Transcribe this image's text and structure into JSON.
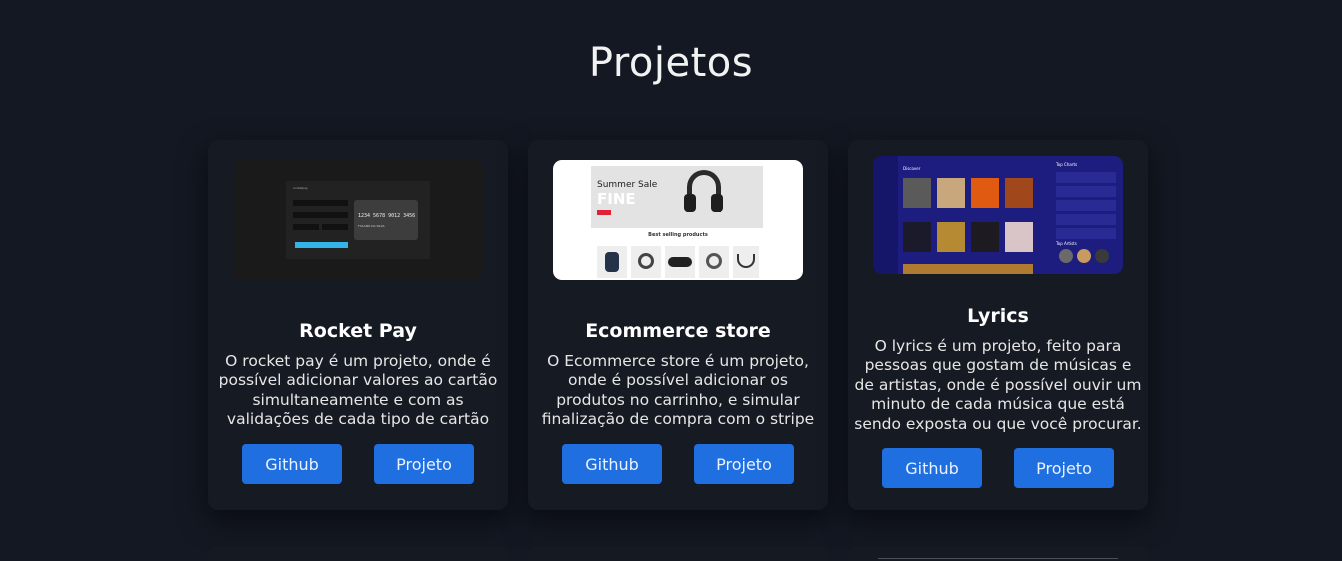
{
  "section": {
    "title": "Projetos"
  },
  "projects": [
    {
      "name": "Rocket Pay",
      "description": "O rocket pay é um projeto, onde é possível adicionar valores ao cartão simultaneamente e com as validações de cada tipo de cartão",
      "github_label": "Github",
      "project_label": "Projeto",
      "preview": {
        "brand": "rocketpay",
        "card_number": "1234 5678 9012 3456",
        "holder": "FULANO DA SILVA",
        "button": "ADICIONAR CARTÃO"
      }
    },
    {
      "name": "Ecommerce store",
      "description": "O Ecommerce store é um projeto, onde é possível adicionar os produtos no carrinho, e simular finalização de compra com o stripe",
      "github_label": "Github",
      "project_label": "Projeto",
      "preview": {
        "banner_title": "Summer Sale",
        "banner_big": "FINE",
        "section": "Best selling products"
      }
    },
    {
      "name": "Lyrics",
      "description": "O lyrics é um projeto, feito para pessoas que gostam de músicas e de artistas, onde é possível ouvir um minuto de cada música que está sendo exposta ou que você procurar.",
      "github_label": "Github",
      "project_label": "Projeto",
      "preview": {
        "heading": "Discover",
        "side_heading": "Top Charts",
        "side_heading2": "Top Artists"
      }
    }
  ],
  "colors": {
    "background": "#131822",
    "card": "#161a22",
    "button": "#1f6fe0"
  }
}
